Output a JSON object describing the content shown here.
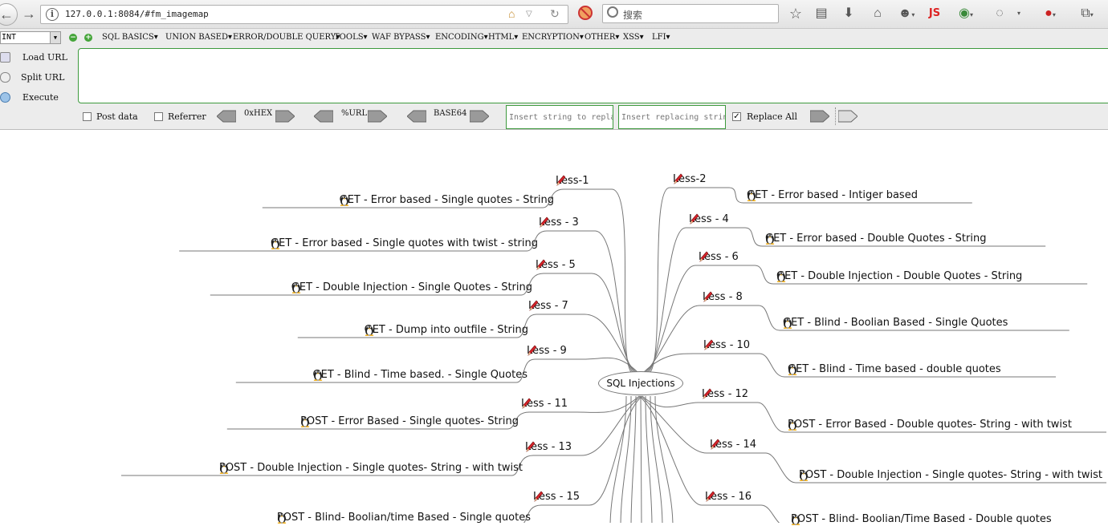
{
  "browser": {
    "url": "127.0.0.1:8084/#fm_imagemap",
    "search_placeholder": "搜索",
    "js_badge": "JS"
  },
  "hackbar": {
    "int_select": "INT",
    "menus": [
      "SQL BASICS▾",
      "UNION BASED▾",
      "ERROR/DOUBLE QUERY▾",
      "TOOLS▾",
      "WAF BYPASS▾",
      "ENCODING▾",
      "HTML▾",
      "ENCRYPTION▾",
      "OTHER▾",
      "XSS▾",
      "LFI▾"
    ],
    "load_url": "Load URL",
    "split_url": "Split URL",
    "execute": "Execute",
    "post_data": "Post data",
    "referrer": "Referrer",
    "hex": "0xHEX",
    "url_enc": "%URL",
    "base64": "BASE64",
    "replace_from_placeholder": "Insert string to replace",
    "replace_to_placeholder": "Insert replacing string",
    "replace_all": "Replace All"
  },
  "mindmap": {
    "center": "SQL Injections",
    "left": [
      {
        "less": "Less-1",
        "title": "GET - Error based - Single quotes - String"
      },
      {
        "less": "Less - 3",
        "title": "GET - Error based - Single quotes with twist - string"
      },
      {
        "less": "Less - 5",
        "title": "GET - Double Injection - Single Quotes - String"
      },
      {
        "less": "Less - 7",
        "title": "GET - Dump into outfile - String"
      },
      {
        "less": "Less - 9",
        "title": "GET - Blind - Time based. -  Single Quotes"
      },
      {
        "less": "Less - 11",
        "title": "POST - Error Based - Single quotes- String"
      },
      {
        "less": "Less - 13",
        "title": "POST - Double Injection - Single quotes- String - with twist"
      },
      {
        "less": "Less - 15",
        "title": "POST - Blind- Boolian/time Based - Single quotes"
      }
    ],
    "right": [
      {
        "less": "Less-2",
        "title": "GET - Error based - Intiger based"
      },
      {
        "less": "Less - 4",
        "title": "GET - Error based - Double Quotes - String"
      },
      {
        "less": "Less - 6",
        "title": "GET - Double Injection - Double Quotes - String"
      },
      {
        "less": "Less - 8",
        "title": "GET - Blind - Boolian Based - Single Quotes"
      },
      {
        "less": "Less - 10",
        "title": "GET - Blind - Time based - double quotes"
      },
      {
        "less": "Less - 12",
        "title": "POST - Error Based - Double quotes- String - with twist"
      },
      {
        "less": "Less - 14",
        "title": "POST - Double Injection - Single quotes- String - with twist"
      },
      {
        "less": "Less - 16",
        "title": "POST - Blind- Boolian/Time Based - Double quotes"
      }
    ]
  }
}
